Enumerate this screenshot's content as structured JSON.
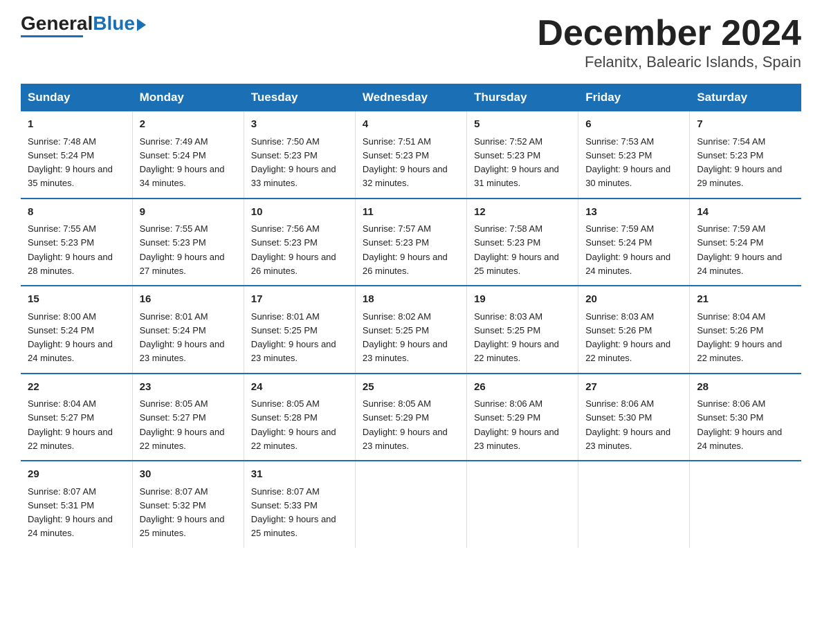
{
  "logo": {
    "text_general": "General",
    "text_blue": "Blue",
    "triangle": "▶"
  },
  "title": "December 2024",
  "subtitle": "Felanitx, Balearic Islands, Spain",
  "days_of_week": [
    "Sunday",
    "Monday",
    "Tuesday",
    "Wednesday",
    "Thursday",
    "Friday",
    "Saturday"
  ],
  "weeks": [
    [
      {
        "day": "1",
        "sunrise": "7:48 AM",
        "sunset": "5:24 PM",
        "daylight": "9 hours and 35 minutes."
      },
      {
        "day": "2",
        "sunrise": "7:49 AM",
        "sunset": "5:24 PM",
        "daylight": "9 hours and 34 minutes."
      },
      {
        "day": "3",
        "sunrise": "7:50 AM",
        "sunset": "5:23 PM",
        "daylight": "9 hours and 33 minutes."
      },
      {
        "day": "4",
        "sunrise": "7:51 AM",
        "sunset": "5:23 PM",
        "daylight": "9 hours and 32 minutes."
      },
      {
        "day": "5",
        "sunrise": "7:52 AM",
        "sunset": "5:23 PM",
        "daylight": "9 hours and 31 minutes."
      },
      {
        "day": "6",
        "sunrise": "7:53 AM",
        "sunset": "5:23 PM",
        "daylight": "9 hours and 30 minutes."
      },
      {
        "day": "7",
        "sunrise": "7:54 AM",
        "sunset": "5:23 PM",
        "daylight": "9 hours and 29 minutes."
      }
    ],
    [
      {
        "day": "8",
        "sunrise": "7:55 AM",
        "sunset": "5:23 PM",
        "daylight": "9 hours and 28 minutes."
      },
      {
        "day": "9",
        "sunrise": "7:55 AM",
        "sunset": "5:23 PM",
        "daylight": "9 hours and 27 minutes."
      },
      {
        "day": "10",
        "sunrise": "7:56 AM",
        "sunset": "5:23 PM",
        "daylight": "9 hours and 26 minutes."
      },
      {
        "day": "11",
        "sunrise": "7:57 AM",
        "sunset": "5:23 PM",
        "daylight": "9 hours and 26 minutes."
      },
      {
        "day": "12",
        "sunrise": "7:58 AM",
        "sunset": "5:23 PM",
        "daylight": "9 hours and 25 minutes."
      },
      {
        "day": "13",
        "sunrise": "7:59 AM",
        "sunset": "5:24 PM",
        "daylight": "9 hours and 24 minutes."
      },
      {
        "day": "14",
        "sunrise": "7:59 AM",
        "sunset": "5:24 PM",
        "daylight": "9 hours and 24 minutes."
      }
    ],
    [
      {
        "day": "15",
        "sunrise": "8:00 AM",
        "sunset": "5:24 PM",
        "daylight": "9 hours and 24 minutes."
      },
      {
        "day": "16",
        "sunrise": "8:01 AM",
        "sunset": "5:24 PM",
        "daylight": "9 hours and 23 minutes."
      },
      {
        "day": "17",
        "sunrise": "8:01 AM",
        "sunset": "5:25 PM",
        "daylight": "9 hours and 23 minutes."
      },
      {
        "day": "18",
        "sunrise": "8:02 AM",
        "sunset": "5:25 PM",
        "daylight": "9 hours and 23 minutes."
      },
      {
        "day": "19",
        "sunrise": "8:03 AM",
        "sunset": "5:25 PM",
        "daylight": "9 hours and 22 minutes."
      },
      {
        "day": "20",
        "sunrise": "8:03 AM",
        "sunset": "5:26 PM",
        "daylight": "9 hours and 22 minutes."
      },
      {
        "day": "21",
        "sunrise": "8:04 AM",
        "sunset": "5:26 PM",
        "daylight": "9 hours and 22 minutes."
      }
    ],
    [
      {
        "day": "22",
        "sunrise": "8:04 AM",
        "sunset": "5:27 PM",
        "daylight": "9 hours and 22 minutes."
      },
      {
        "day": "23",
        "sunrise": "8:05 AM",
        "sunset": "5:27 PM",
        "daylight": "9 hours and 22 minutes."
      },
      {
        "day": "24",
        "sunrise": "8:05 AM",
        "sunset": "5:28 PM",
        "daylight": "9 hours and 22 minutes."
      },
      {
        "day": "25",
        "sunrise": "8:05 AM",
        "sunset": "5:29 PM",
        "daylight": "9 hours and 23 minutes."
      },
      {
        "day": "26",
        "sunrise": "8:06 AM",
        "sunset": "5:29 PM",
        "daylight": "9 hours and 23 minutes."
      },
      {
        "day": "27",
        "sunrise": "8:06 AM",
        "sunset": "5:30 PM",
        "daylight": "9 hours and 23 minutes."
      },
      {
        "day": "28",
        "sunrise": "8:06 AM",
        "sunset": "5:30 PM",
        "daylight": "9 hours and 24 minutes."
      }
    ],
    [
      {
        "day": "29",
        "sunrise": "8:07 AM",
        "sunset": "5:31 PM",
        "daylight": "9 hours and 24 minutes."
      },
      {
        "day": "30",
        "sunrise": "8:07 AM",
        "sunset": "5:32 PM",
        "daylight": "9 hours and 25 minutes."
      },
      {
        "day": "31",
        "sunrise": "8:07 AM",
        "sunset": "5:33 PM",
        "daylight": "9 hours and 25 minutes."
      },
      null,
      null,
      null,
      null
    ]
  ],
  "labels": {
    "sunrise": "Sunrise:",
    "sunset": "Sunset:",
    "daylight": "Daylight: "
  },
  "accent_color": "#1a6fb5"
}
